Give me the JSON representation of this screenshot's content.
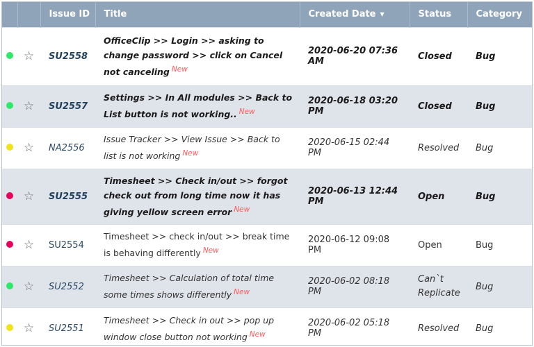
{
  "colors": {
    "header_bg": "#8fa4b8",
    "row_shade": "#dfe3ea",
    "status_green": "#2ee86a",
    "status_yellow": "#f2e21c",
    "status_red": "#e8005b",
    "new_badge": "#ff5a5a"
  },
  "table": {
    "headers": {
      "issue_id": "Issue ID",
      "title": "Title",
      "created_date": "Created Date",
      "status": "Status",
      "category": "Category"
    },
    "sort_icon": "caret-down-icon",
    "rows": [
      {
        "dot": "green",
        "issue_id": "SU2558",
        "title": "OfficeClip >> Login >> asking to change password >> click on Cancel not canceling",
        "new_label": "New",
        "created_date": "2020-06-20 07:36 AM",
        "status": "Closed",
        "category": "Bug"
      },
      {
        "dot": "green",
        "issue_id": "SU2557",
        "title": "Settings >> In All modules >> Back to List button is not working..",
        "new_label": "New",
        "created_date": "2020-06-18 03:20 PM",
        "status": "Closed",
        "category": "Bug"
      },
      {
        "dot": "yellow",
        "issue_id": "NA2556",
        "title": "Issue Tracker >> View Issue >> Back to list is not working",
        "new_label": "New",
        "created_date": "2020-06-15 02:44 PM",
        "status": "Resolved",
        "category": "Bug"
      },
      {
        "dot": "red",
        "issue_id": "SU2555",
        "title": "Timesheet >> Check in/out >> forgot check out from long time now it has giving yellow screen error",
        "new_label": "New",
        "created_date": "2020-06-13 12:44 PM",
        "status": "Open",
        "category": "Bug"
      },
      {
        "dot": "red",
        "issue_id": "SU2554",
        "title": "Timesheet >> check in/out >> break time is behaving differently",
        "new_label": "New",
        "created_date": "2020-06-12 09:08 PM",
        "status": "Open",
        "category": "Bug"
      },
      {
        "dot": "green",
        "issue_id": "SU2552",
        "title": "Timesheet >> Calculation of total time some times shows differently",
        "new_label": "New",
        "created_date": "2020-06-02 08:18 PM",
        "status": "Can`t Replicate",
        "category": "Bug"
      },
      {
        "dot": "yellow",
        "issue_id": "SU2551",
        "title": "Timesheet >> Check in out >> pop up window close button not working",
        "new_label": "New",
        "created_date": "2020-06-02 05:18 PM",
        "status": "Resolved",
        "category": "Bug"
      }
    ]
  }
}
